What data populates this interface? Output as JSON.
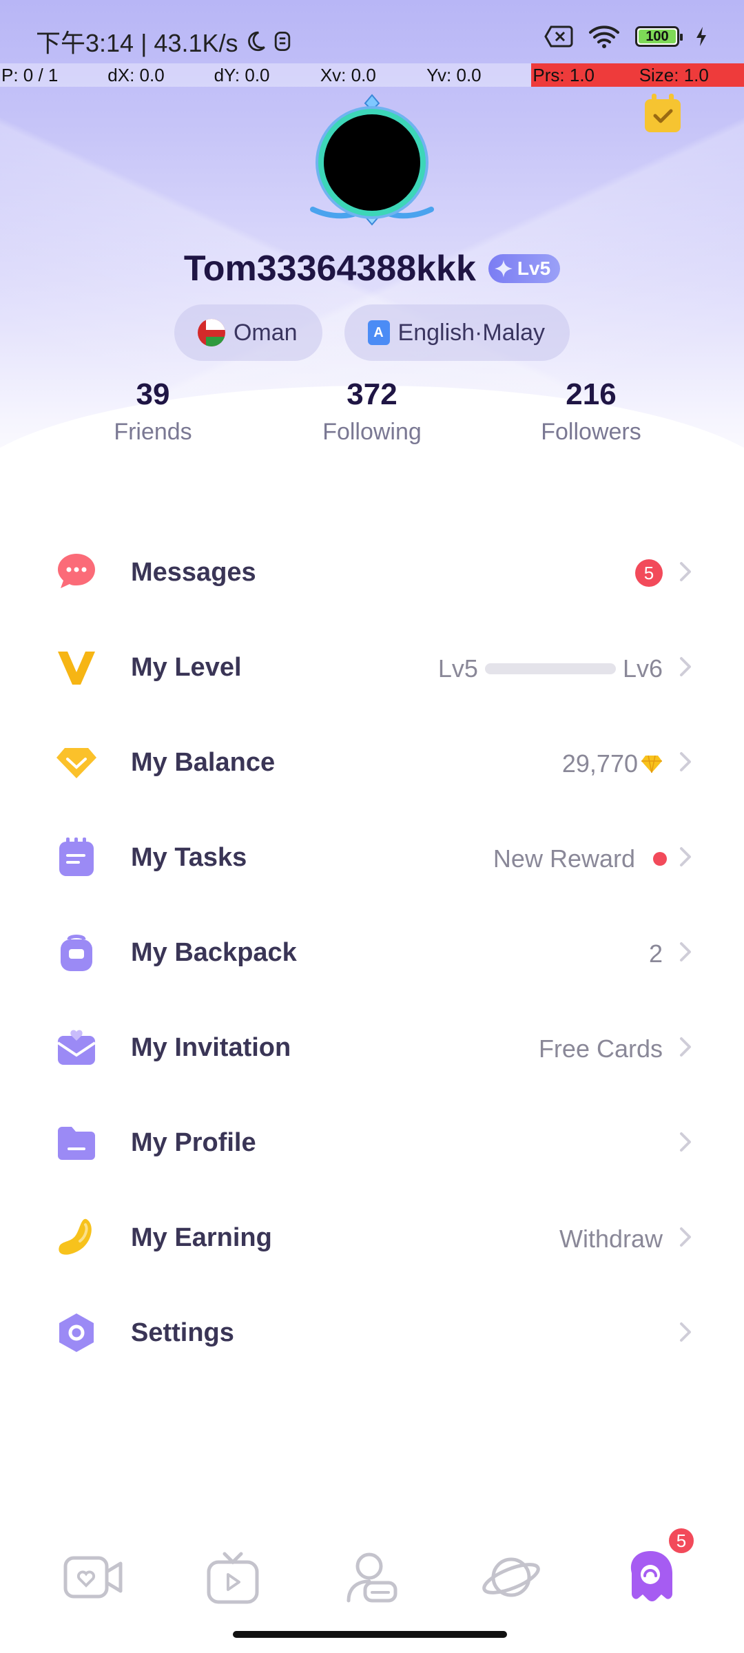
{
  "status_bar": {
    "time_speed": "下午3:14 | 43.1K/s",
    "battery": "100"
  },
  "debug": {
    "p": "P: 0 / 1",
    "dx": "dX: 0.0",
    "dy": "dY: 0.0",
    "xv": "Xv: 0.0",
    "yv": "Yv: 0.0",
    "prs": "Prs: 1.0",
    "size": "Size: 1.0"
  },
  "profile": {
    "username": "Tom33364388kkk",
    "level_badge": "Lv5",
    "country": "Oman",
    "languages": "English·Malay",
    "language_icon_letter": "A"
  },
  "stats": [
    {
      "value": "39",
      "label": "Friends"
    },
    {
      "value": "372",
      "label": "Following"
    },
    {
      "value": "216",
      "label": "Followers"
    }
  ],
  "menu": {
    "messages": {
      "label": "Messages",
      "badge": "5"
    },
    "level": {
      "label": "My Level",
      "from": "Lv5",
      "to": "Lv6",
      "progress": 0.0
    },
    "balance": {
      "label": "My Balance",
      "value": "29,770"
    },
    "tasks": {
      "label": "My Tasks",
      "value": "New Reward"
    },
    "backpack": {
      "label": "My Backpack",
      "value": "2"
    },
    "invitation": {
      "label": "My Invitation",
      "value": "Free Cards"
    },
    "profile": {
      "label": "My Profile"
    },
    "earning": {
      "label": "My Earning",
      "value": "Withdraw"
    },
    "settings": {
      "label": "Settings"
    }
  },
  "bottom_nav": {
    "items": [
      "video-chat-icon",
      "live-tv-icon",
      "contacts-icon",
      "planet-icon",
      "me-icon"
    ],
    "active": "me-icon",
    "me_badge": "5"
  },
  "colors": {
    "accent": "#8b87f3",
    "title_text": "#1f1544",
    "badge_red": "#f24a5a"
  }
}
